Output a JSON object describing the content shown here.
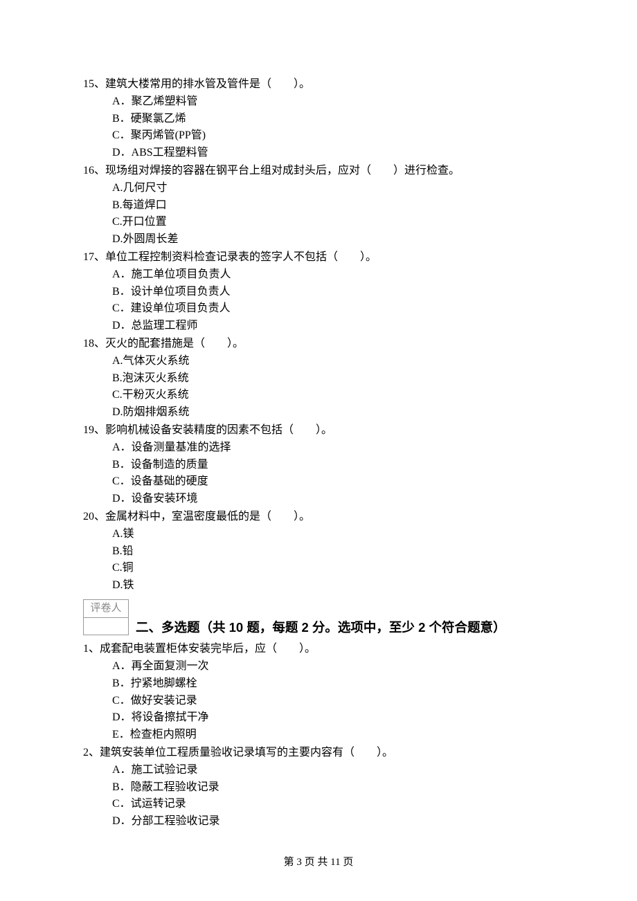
{
  "questions_single": [
    {
      "num": "15、",
      "text": "建筑大楼常用的排水管及管件是（　　）。",
      "options": [
        "A．聚乙烯塑料管",
        "B．硬聚氯乙烯",
        "C．聚丙烯管(PP管)",
        "D．ABS工程塑料管"
      ]
    },
    {
      "num": "16、",
      "text": "现场组对焊接的容器在钢平台上组对成封头后，应对（　　）进行检查。",
      "options": [
        "A.几何尺寸",
        "B.每道焊口",
        "C.开口位置",
        "D.外圆周长差"
      ]
    },
    {
      "num": "17、",
      "text": "单位工程控制资料检查记录表的签字人不包括（　　）。",
      "options": [
        "A．施工单位项目负责人",
        "B．设计单位项目负责人",
        "C．建设单位项目负责人",
        "D．总监理工程师"
      ]
    },
    {
      "num": "18、",
      "text": "灭火的配套措施是（　　）。",
      "options": [
        "A.气体灭火系统",
        "B.泡沫灭火系统",
        "C.干粉灭火系统",
        "D.防烟排烟系统"
      ]
    },
    {
      "num": "19、",
      "text": "影响机械设备安装精度的因素不包括（　　）。",
      "options": [
        "A．设备测量基准的选择",
        "B．设备制造的质量",
        "C．设备基础的硬度",
        "D．设备安装环境"
      ]
    },
    {
      "num": "20、",
      "text": "金属材料中，室温密度最低的是（　　）。",
      "options": [
        "A.镁",
        "B.铅",
        "C.铜",
        "D.铁"
      ]
    }
  ],
  "grader_label": "评卷人",
  "section2_title": "二、多选题（共 10 题，每题 2 分。选项中，至少 2 个符合题意）",
  "questions_multi": [
    {
      "num": "1、",
      "text": "成套配电装置柜体安装完毕后，应（　　）。",
      "options": [
        "A．再全面复测一次",
        "B．拧紧地脚螺栓",
        "C．做好安装记录",
        "D．将设备擦拭干净",
        "E．检查柜内照明"
      ]
    },
    {
      "num": "2、",
      "text": "建筑安装单位工程质量验收记录填写的主要内容有（　　）。",
      "options": [
        "A．施工试验记录",
        "B．隐蔽工程验收记录",
        "C．试运转记录",
        "D．分部工程验收记录"
      ]
    }
  ],
  "footer": "第 3 页 共 11 页"
}
